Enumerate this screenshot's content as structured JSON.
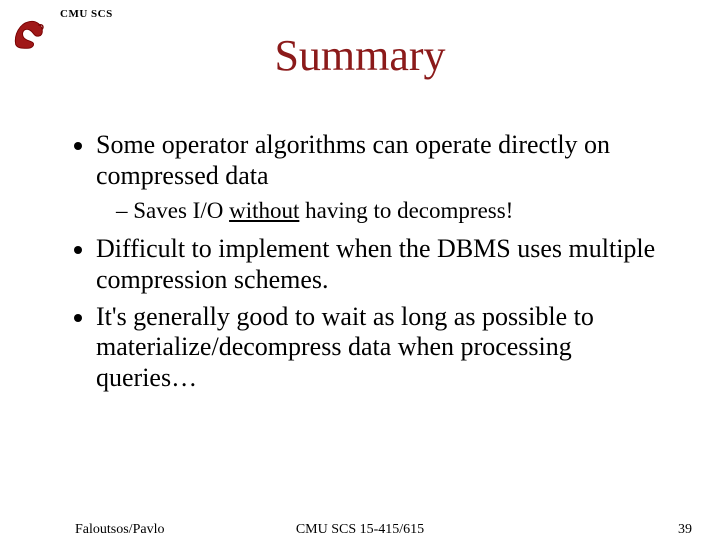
{
  "header": {
    "org_label": "CMU SCS"
  },
  "title": "Summary",
  "bullets": {
    "b1": "Some operator algorithms can operate directly on compressed data",
    "b1_sub_prefix": "Saves I/O ",
    "b1_sub_underlined": "without",
    "b1_sub_suffix": " having to decompress!",
    "b2": "Difficult to implement when the DBMS uses multiple compression schemes.",
    "b3": "It's generally good to wait as long as possible to materialize/decompress data when processing queries…"
  },
  "footer": {
    "left": "Faloutsos/Pavlo",
    "center": "CMU SCS 15-415/615",
    "right": "39"
  }
}
